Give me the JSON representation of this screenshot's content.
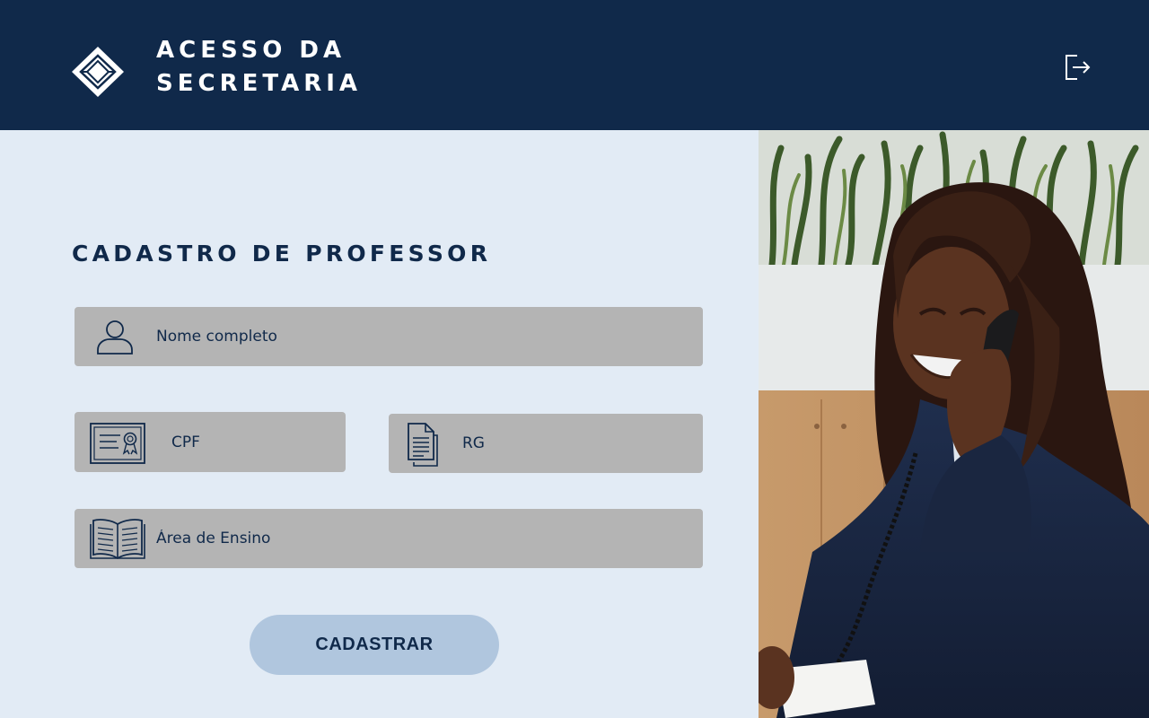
{
  "header": {
    "title_line1": "ACESSO DA",
    "title_line2": "SECRETARIA",
    "logo_icon": "diamond-logo-icon",
    "logout_icon": "logout-icon"
  },
  "form": {
    "title": "CADASTRO DE PROFESSOR",
    "fields": {
      "nome": {
        "placeholder": "Nome completo",
        "icon": "user-icon"
      },
      "cpf": {
        "placeholder": "CPF",
        "icon": "certificate-icon"
      },
      "rg": {
        "placeholder": "RG",
        "icon": "document-icon"
      },
      "area": {
        "placeholder": "Área de Ensino",
        "icon": "open-book-icon"
      }
    },
    "submit_label": "CADASTRAR"
  },
  "photo": {
    "subject": "secretary-on-phone-photo"
  },
  "colors": {
    "header_bg": "#10294a",
    "page_bg": "#e2ebf5",
    "field_bg": "#b4b4b4",
    "button_bg": "#b0c6de",
    "text_dark": "#10294a"
  }
}
